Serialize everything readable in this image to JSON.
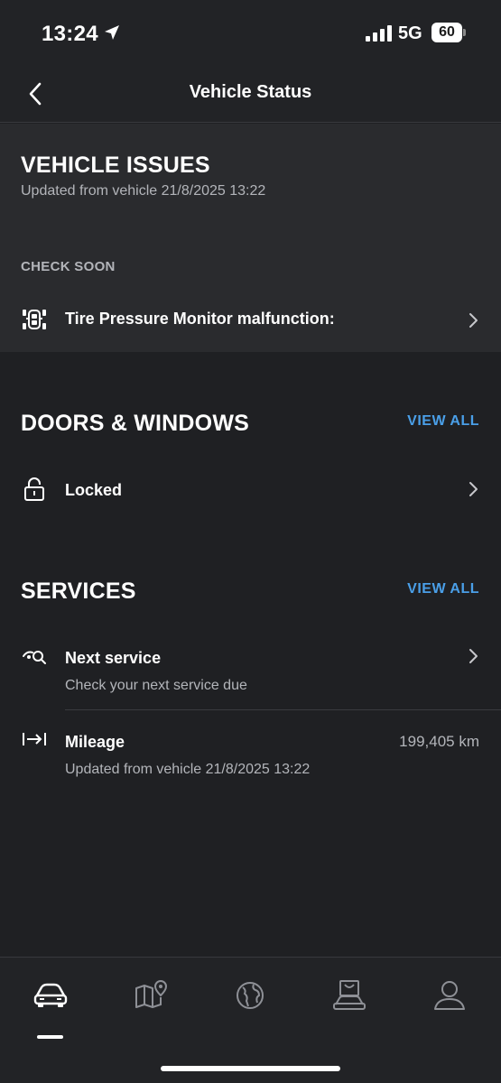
{
  "status_bar": {
    "time": "13:24",
    "network": "5G",
    "battery": "60"
  },
  "header": {
    "title": "Vehicle Status"
  },
  "vehicle_issues": {
    "title": "VEHICLE ISSUES",
    "updated": "Updated from vehicle 21/8/2025 13:22",
    "group_label": "CHECK SOON",
    "items": [
      {
        "label": "Tire Pressure Monitor malfunction:"
      }
    ]
  },
  "doors_windows": {
    "title": "DOORS & WINDOWS",
    "view_all": "VIEW ALL",
    "status": "Locked"
  },
  "services": {
    "title": "SERVICES",
    "view_all": "VIEW ALL",
    "next_service": {
      "label": "Next service",
      "sub": "Check your next service due"
    },
    "mileage": {
      "label": "Mileage",
      "sub": "Updated from vehicle 21/8/2025 13:22",
      "value": "199,405 km"
    }
  },
  "tab_bar": {
    "active": "vehicle",
    "tabs": [
      "vehicle",
      "map",
      "globe",
      "shop",
      "profile"
    ]
  },
  "colors": {
    "background": "#1f2023",
    "panel": "#2a2b2e",
    "accent": "#4a9fe8",
    "secondary_text": "#b3b5ba"
  }
}
